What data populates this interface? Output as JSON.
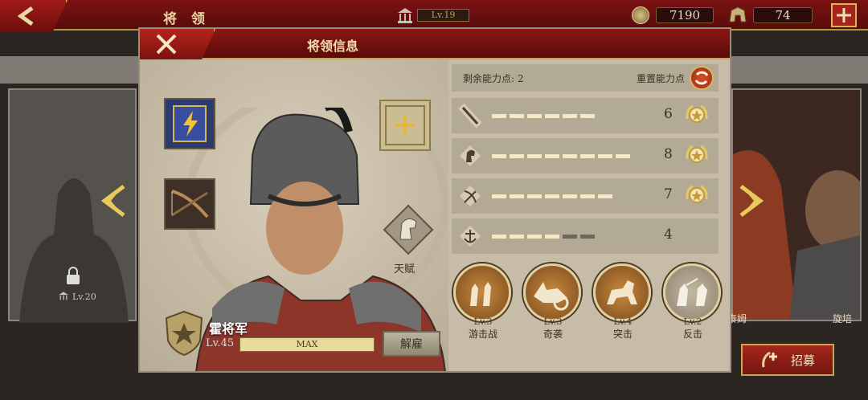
{
  "topbar": {
    "title": "将 领",
    "level": "Lv.19",
    "coins": "7190",
    "troops": "74"
  },
  "dialog": {
    "title": "将领信息",
    "general": {
      "name": "霍将军",
      "level": "Lv.45",
      "exp_label": "MAX",
      "dismiss_label": "解雇",
      "talent_label": "天赋"
    },
    "stats": {
      "remaining_label": "剩余能力点:",
      "remaining_value": "2",
      "reset_label": "重置能力点",
      "rows": [
        {
          "name": "attack",
          "value": "6",
          "filled": 6,
          "total": 6,
          "star": true
        },
        {
          "name": "cavalry",
          "value": "8",
          "filled": 8,
          "total": 8,
          "star": true
        },
        {
          "name": "ranged",
          "value": "7",
          "filled": 7,
          "total": 7,
          "star": true
        },
        {
          "name": "navy",
          "value": "4",
          "filled": 4,
          "total": 6,
          "star": false
        }
      ]
    },
    "skills": [
      {
        "level": "Lv.3",
        "name": "游击战"
      },
      {
        "level": "Lv.3",
        "name": "奇袭"
      },
      {
        "level": "Lv.4",
        "name": "突击"
      },
      {
        "level": "Lv.2",
        "name": "反击"
      }
    ]
  },
  "side": {
    "locked_level": "Lv.20",
    "right_name": "旋培",
    "right_name2": "泰姆",
    "recruit_label": "招募"
  },
  "colors": {
    "header_red": "#7a1212",
    "gold": "#caa451",
    "panel": "#c7bca7"
  }
}
